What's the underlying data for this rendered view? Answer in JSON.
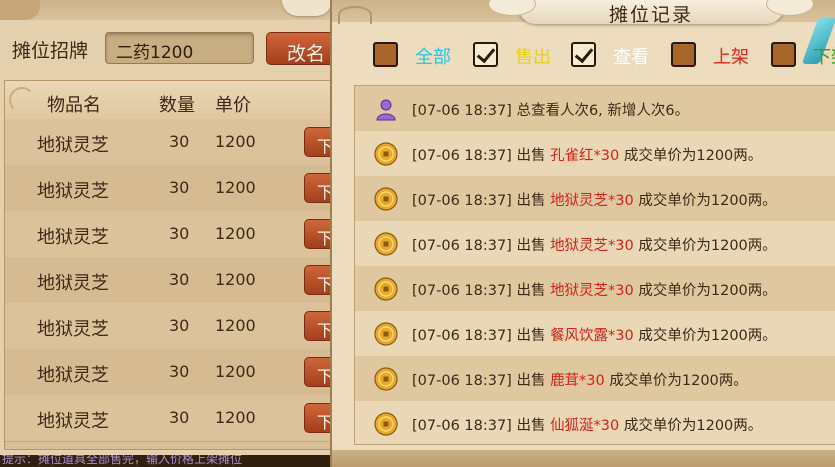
{
  "stall": {
    "sign_label": "摊位招牌",
    "sign_value": "二药1200",
    "rename_label": "改名",
    "headers": {
      "name": "物品名",
      "quantity": "数量",
      "price": "单价"
    },
    "rows": [
      {
        "name": "地狱灵芝",
        "quantity": "30",
        "price": "1200",
        "action": "下架"
      },
      {
        "name": "地狱灵芝",
        "quantity": "30",
        "price": "1200",
        "action": "下架"
      },
      {
        "name": "地狱灵芝",
        "quantity": "30",
        "price": "1200",
        "action": "下架"
      },
      {
        "name": "地狱灵芝",
        "quantity": "30",
        "price": "1200",
        "action": "下架"
      },
      {
        "name": "地狱灵芝",
        "quantity": "30",
        "price": "1200",
        "action": "下架"
      },
      {
        "name": "地狱灵芝",
        "quantity": "30",
        "price": "1200",
        "action": "下架"
      },
      {
        "name": "地狱灵芝",
        "quantity": "30",
        "price": "1200",
        "action": "下架"
      }
    ],
    "bottom_hint": "提示：摊位道具全部售完，输入价格上架摊位"
  },
  "records": {
    "title": "摊位记录",
    "filters": [
      {
        "label": "全部",
        "checked": false,
        "color": "#22c8e8"
      },
      {
        "label": "售出",
        "checked": true,
        "color": "#e8d020"
      },
      {
        "label": "查看",
        "checked": true,
        "color": "#ffffff"
      },
      {
        "label": "上架",
        "checked": false,
        "color": "#e02818"
      },
      {
        "label": "下架",
        "checked": false,
        "color": "#3a9a2a"
      }
    ],
    "entries": [
      {
        "icon": "person-icon",
        "prefix": "[07-06 18:37] 总查看人次6, 新增人次6。",
        "item": "",
        "suffix": ""
      },
      {
        "icon": "coin-icon",
        "prefix": "[07-06 18:37] 出售 ",
        "item": "孔雀红*30",
        "suffix": " 成交单价为1200两。"
      },
      {
        "icon": "coin-icon",
        "prefix": "[07-06 18:37] 出售 ",
        "item": "地狱灵芝*30",
        "suffix": " 成交单价为1200两。"
      },
      {
        "icon": "coin-icon",
        "prefix": "[07-06 18:37] 出售 ",
        "item": "地狱灵芝*30",
        "suffix": " 成交单价为1200两。"
      },
      {
        "icon": "coin-icon",
        "prefix": "[07-06 18:37] 出售 ",
        "item": "地狱灵芝*30",
        "suffix": " 成交单价为1200两。"
      },
      {
        "icon": "coin-icon",
        "prefix": "[07-06 18:37] 出售 ",
        "item": "餐风饮露*30",
        "suffix": " 成交单价为1200两。"
      },
      {
        "icon": "coin-icon",
        "prefix": "[07-06 18:37] 出售 ",
        "item": "鹿茸*30",
        "suffix": " 成交单价为1200两。"
      },
      {
        "icon": "coin-icon",
        "prefix": "[07-06 18:37] 出售 ",
        "item": "仙狐涎*30",
        "suffix": " 成交单价为1200两。"
      }
    ]
  }
}
